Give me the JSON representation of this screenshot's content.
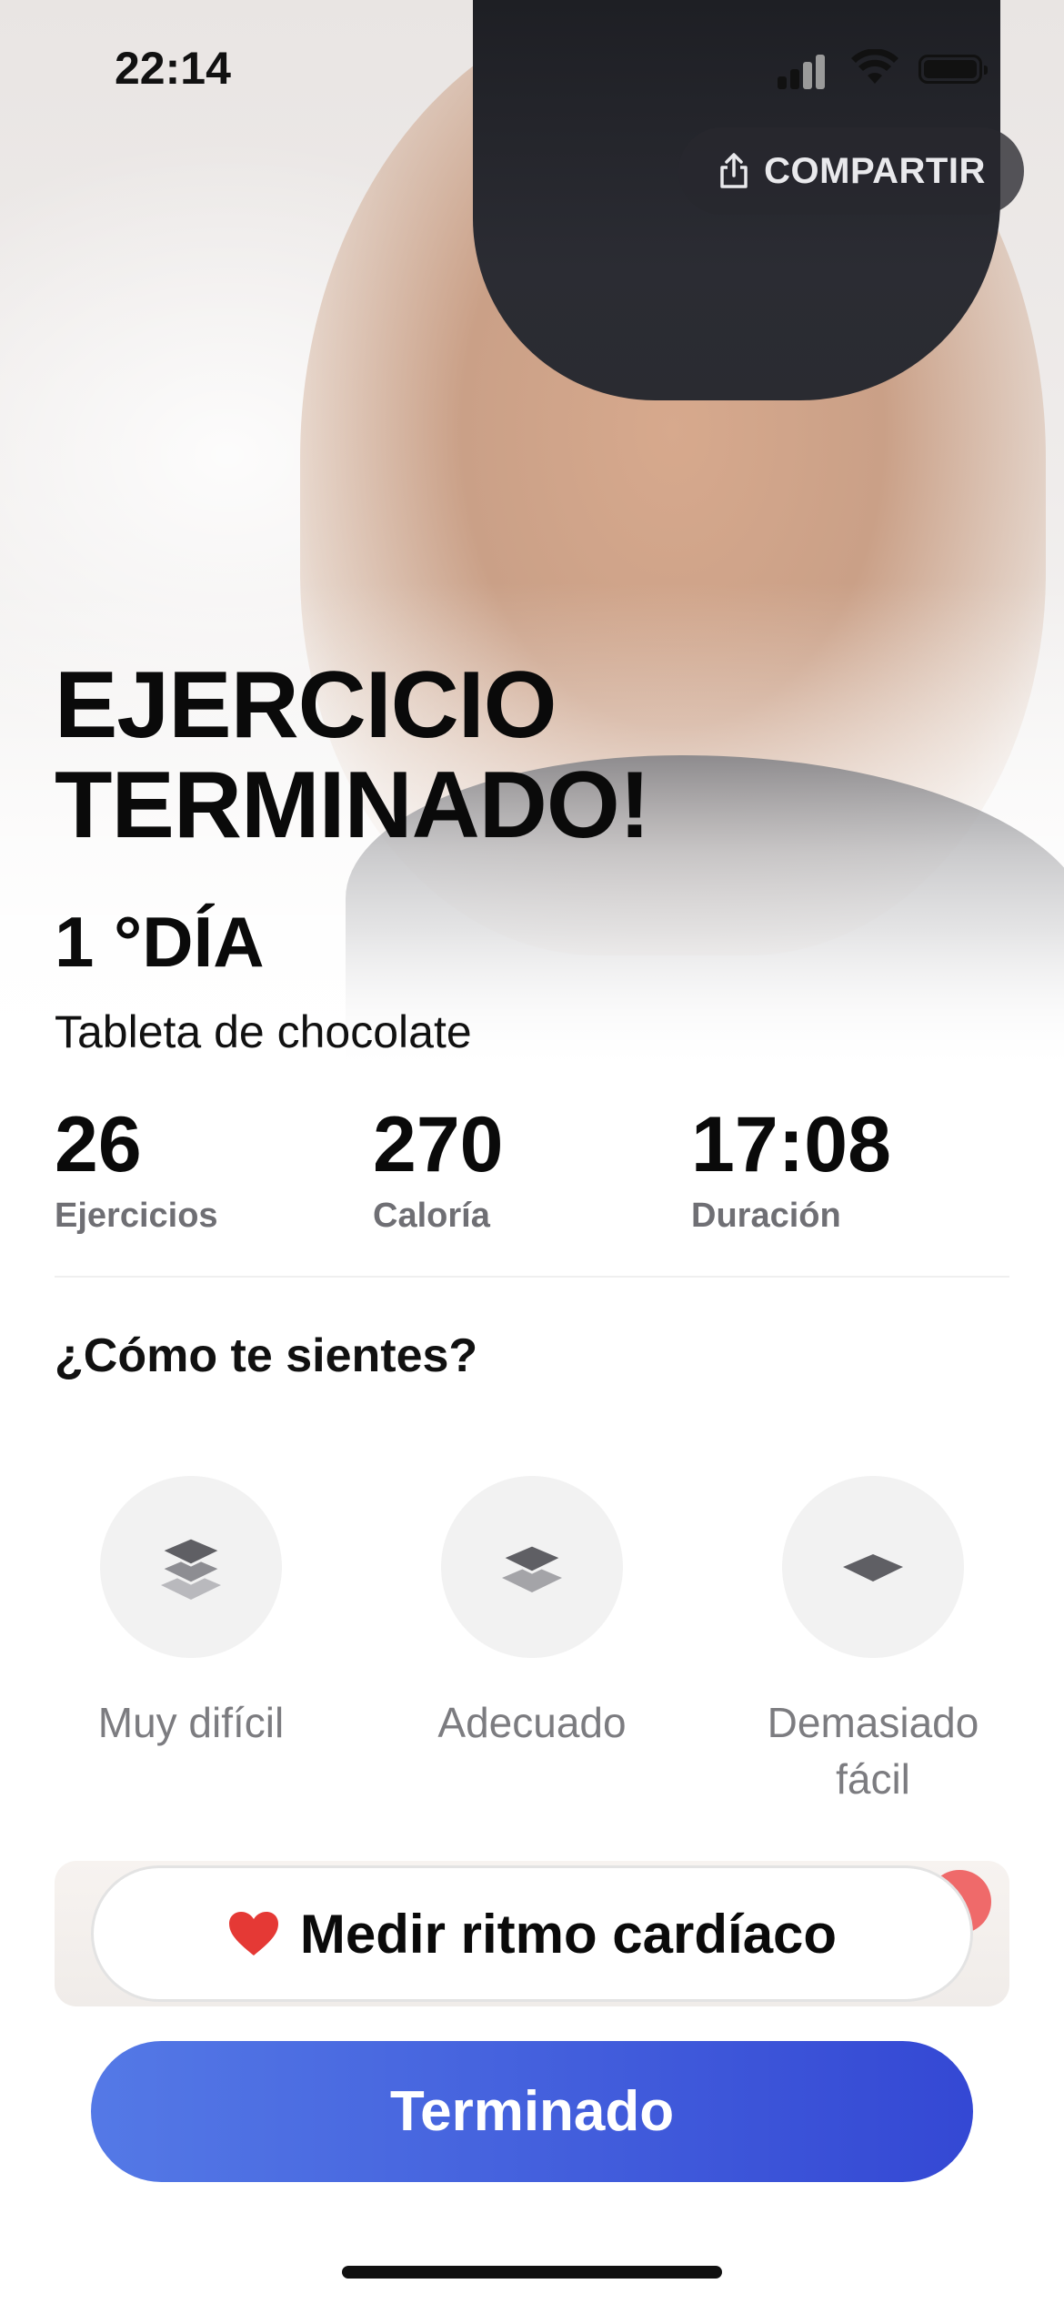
{
  "status_bar": {
    "time": "22:14"
  },
  "header": {
    "share_label": "COMPARTIR"
  },
  "summary": {
    "title_line1": "EJERCICIO",
    "title_line2": "TERMINADO!",
    "day": "1 °DÍA",
    "plan_name": "Tableta de chocolate"
  },
  "stats": [
    {
      "value": "26",
      "label": "Ejercicios"
    },
    {
      "value": "270",
      "label": "Caloría"
    },
    {
      "value": "17:08",
      "label": "Duración"
    }
  ],
  "feedback": {
    "question": "¿Cómo te sientes?",
    "options": [
      {
        "label": "Muy difícil",
        "icon": "layers-three-icon"
      },
      {
        "label": "Adecuado",
        "icon": "layers-two-icon"
      },
      {
        "label": "Demasiado\nfácil",
        "icon": "layer-one-icon"
      }
    ]
  },
  "actions": {
    "heart_rate_label": "Medir ritmo cardíaco",
    "done_label": "Terminado"
  },
  "colors": {
    "primary_gradient_start": "#5479e6",
    "primary_gradient_end": "#3448d4",
    "heart": "#e53935",
    "muted_text": "#6f6f74"
  }
}
